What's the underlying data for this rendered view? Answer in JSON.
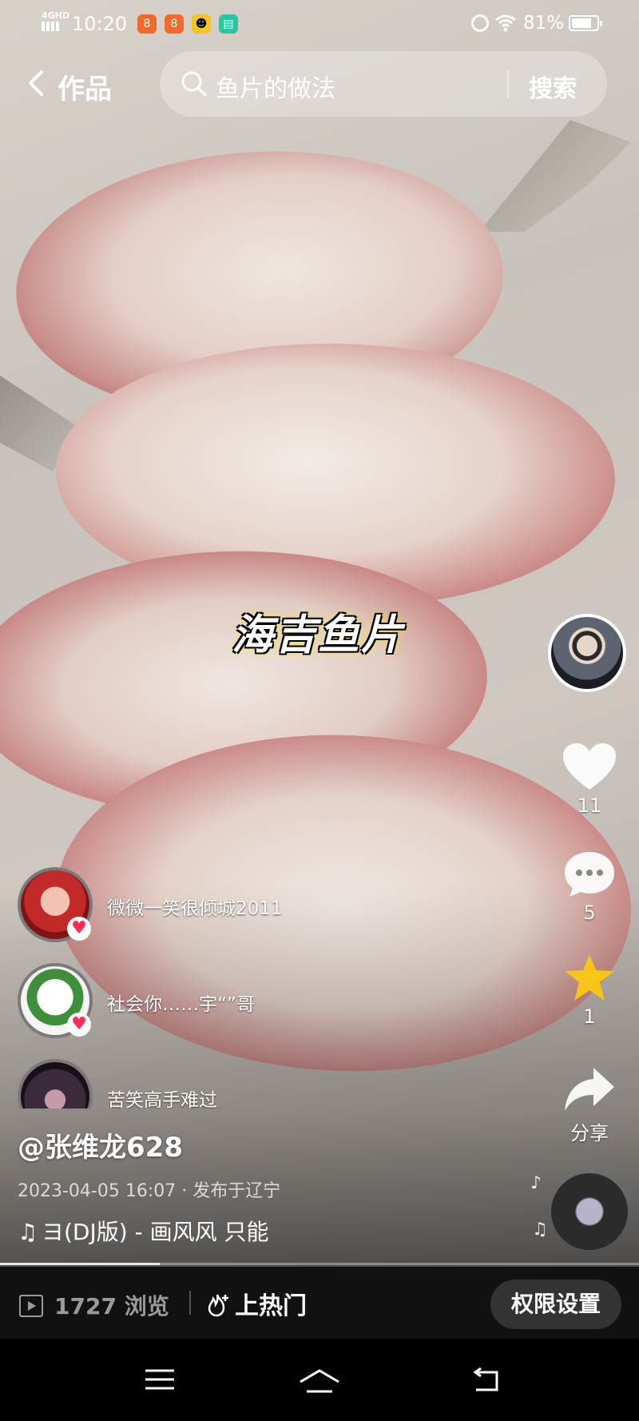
{
  "status_bar": {
    "network": "4GHD",
    "time": "10:20",
    "battery_percent": "81%",
    "battery_level": 0.81
  },
  "header": {
    "back_label": "作品",
    "search_query": "鱼片的做法",
    "search_button": "搜索"
  },
  "video": {
    "caption": "海吉鱼片"
  },
  "actions": {
    "likes": "11",
    "comments": "5",
    "favorites": "1",
    "share_label": "分享"
  },
  "comments": [
    {
      "text": "微微一笑很倾城2011"
    },
    {
      "text": "社会你……宇“”哥"
    },
    {
      "text": "苦笑高手难过"
    }
  ],
  "post": {
    "author": "@张维龙628",
    "meta": "2023-04-05 16:07 · 发布于辽宁",
    "music": "ヨ(DJ版) - 画风风    只能",
    "progress": 0.25
  },
  "bottom_bar": {
    "views_count": "1727",
    "views_label": "浏览",
    "hot_label": "上热门",
    "permission_button": "权限设置"
  },
  "icons": {
    "back": "chevron-left-icon",
    "search": "search-icon",
    "like": "heart-icon",
    "comment": "chat-bubble-icon",
    "favorite": "star-icon",
    "share": "share-arrow-icon"
  },
  "colors": {
    "favorite": "#f5c518",
    "like_badge": "#ff2b54"
  }
}
